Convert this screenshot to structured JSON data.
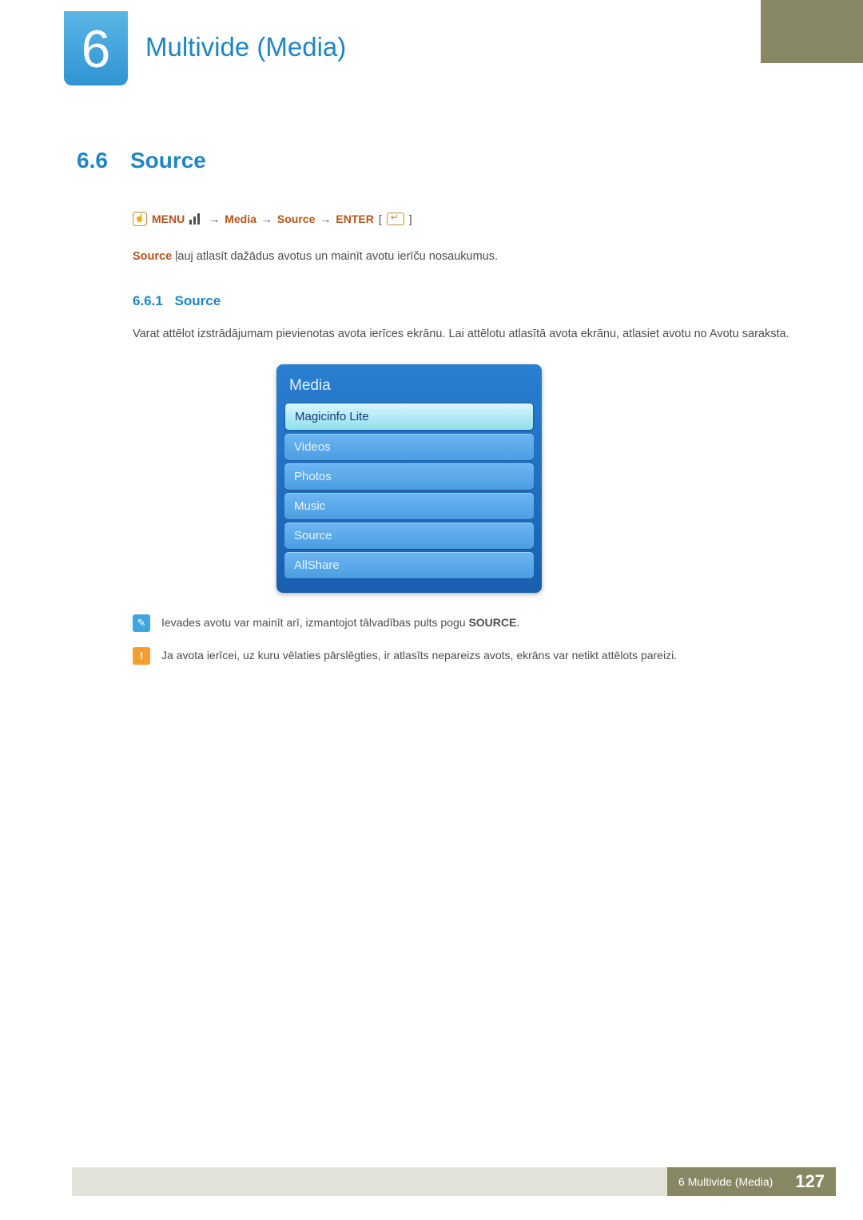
{
  "chapter": {
    "number": "6",
    "title": "Multivide (Media)"
  },
  "section": {
    "number": "6.6",
    "title": "Source"
  },
  "nav": {
    "menu": "MENU",
    "arrow": "→",
    "media": "Media",
    "source": "Source",
    "enter": "ENTER",
    "bracket_open": "[",
    "bracket_close": "]"
  },
  "lead": {
    "kw": "Source",
    "rest": " ļauj atlasīt dažādus avotus un mainīt avotu ierīču nosaukumus."
  },
  "subsection": {
    "number": "6.6.1",
    "title": "Source"
  },
  "body": "Varat attēlot izstrādājumam pievienotas avota ierīces ekrānu. Lai attēlotu atlasītā avota ekrānu, atlasiet avotu no Avotu saraksta.",
  "menu_panel": {
    "title": "Media",
    "items": [
      {
        "label": "Magicinfo Lite",
        "selected": true
      },
      {
        "label": "Videos",
        "selected": false
      },
      {
        "label": "Photos",
        "selected": false
      },
      {
        "label": "Music",
        "selected": false
      },
      {
        "label": "Source",
        "selected": false
      },
      {
        "label": "AllShare",
        "selected": false
      }
    ]
  },
  "notes": {
    "info_pre": "Ievades avotu var mainīt arī, izmantojot tālvadības pults pogu ",
    "info_kw": "SOURCE",
    "info_post": ".",
    "warn": "Ja avota ierīcei, uz kuru vēlaties pārslēgties, ir atlasīts nepareizs avots, ekrāns var netikt attēlots pareizi."
  },
  "icons": {
    "info": "✎",
    "warn": "!"
  },
  "footer": {
    "chapter_ref_num": "6",
    "chapter_ref_title": "Multivide (Media)",
    "page": "127"
  }
}
